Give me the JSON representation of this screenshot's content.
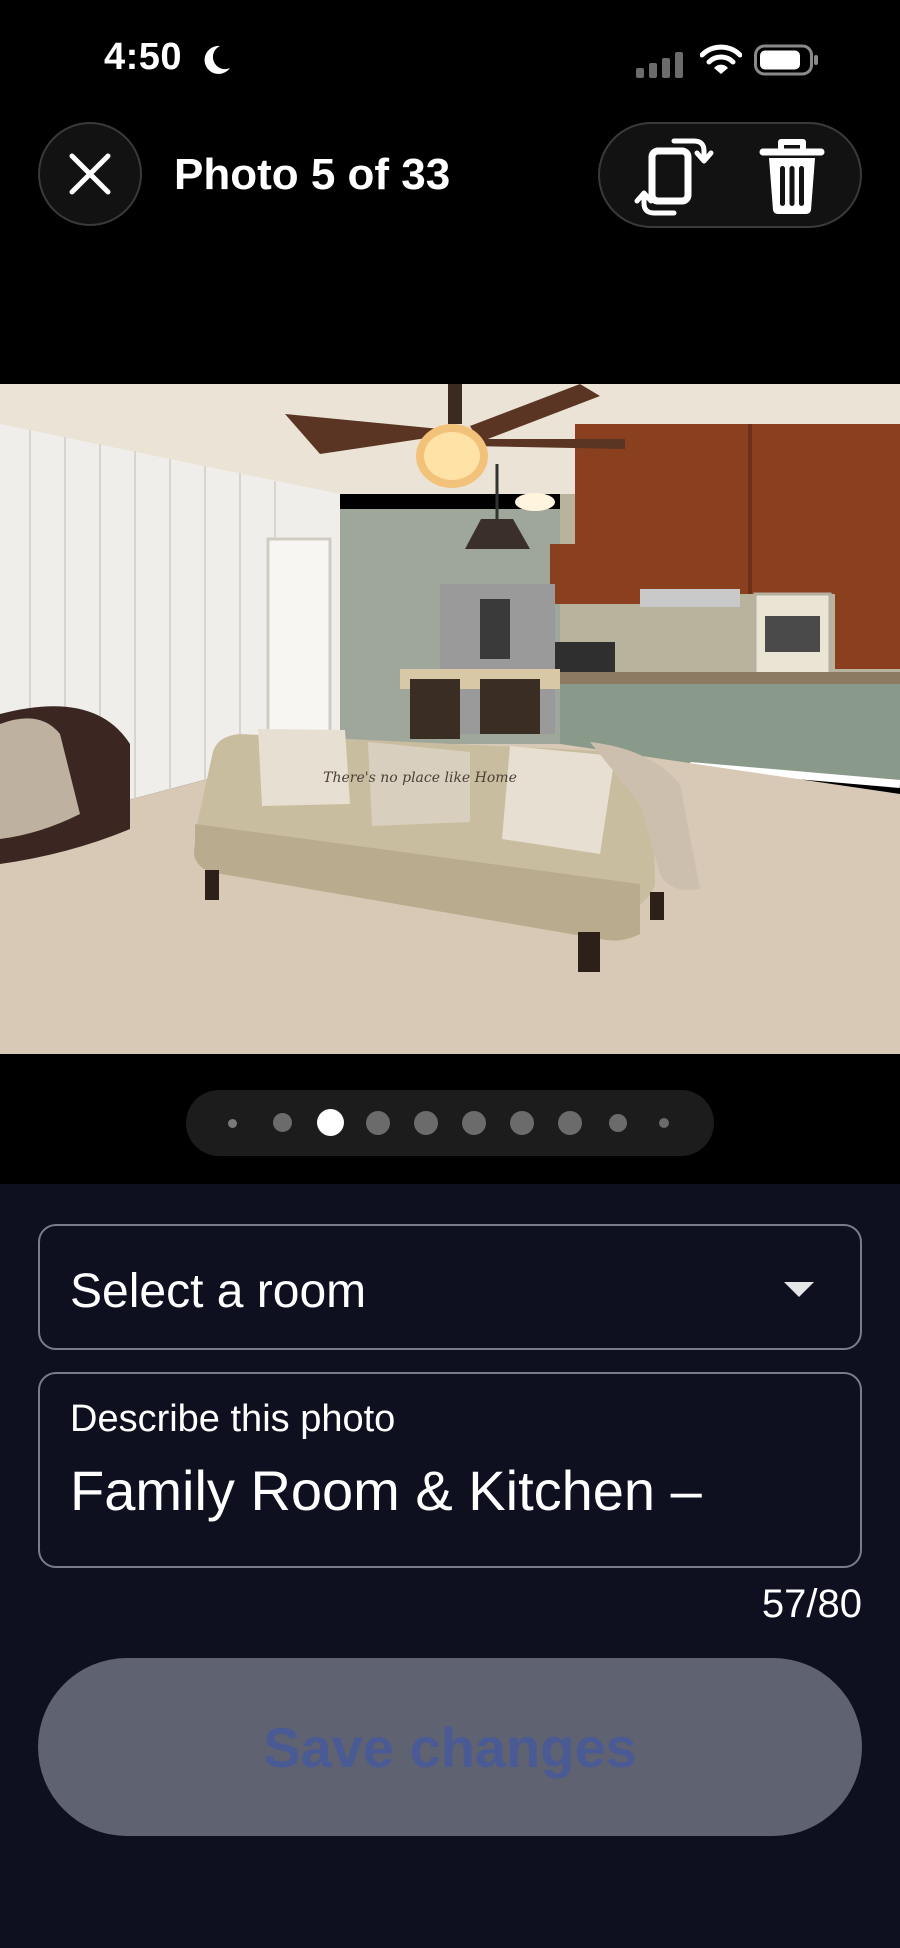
{
  "status_bar": {
    "time": "4:50",
    "icons": [
      "moon-icon",
      "signal-icon",
      "wifi-icon",
      "battery-icon"
    ]
  },
  "header": {
    "title": "Photo 5 of 33",
    "close_icon": "close-icon",
    "actions": [
      "rotate-icon",
      "trash-icon"
    ]
  },
  "photo": {
    "pillow_text": "There's no place like Home"
  },
  "pager": {
    "dot_count": 10,
    "active_index": 2
  },
  "form": {
    "room_select": {
      "value": "Select a room"
    },
    "description": {
      "label": "Describe this photo",
      "value": "Family Room & Kitchen –"
    },
    "char_count": "57/80",
    "save_label": "Save changes"
  },
  "colors": {
    "panel_bg": "#0e1020",
    "save_button_bg": "#5f6270",
    "save_button_text": "#4a5a95",
    "field_border": "#7a7c8a"
  }
}
